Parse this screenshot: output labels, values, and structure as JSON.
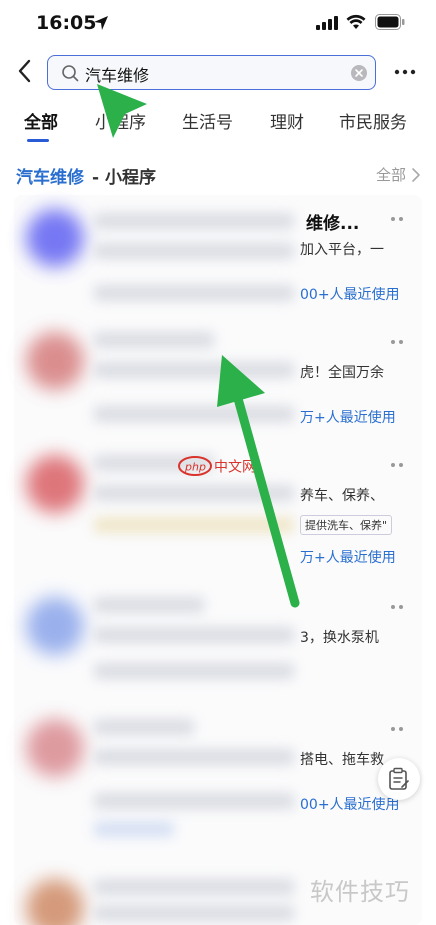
{
  "status_bar": {
    "time": "16:05"
  },
  "search": {
    "query": "汽车维修"
  },
  "tabs": [
    {
      "label": "全部",
      "active": true
    },
    {
      "label": "小程序",
      "active": false
    },
    {
      "label": "生活号",
      "active": false
    },
    {
      "label": "理财",
      "active": false
    },
    {
      "label": "市民服务",
      "active": false
    }
  ],
  "section": {
    "keyword": "汽车维修",
    "rest": " - 小程序",
    "all_label": "全部"
  },
  "results": [
    {
      "title": "维修...",
      "desc": "加入平台，一",
      "users": "00+人最近使用",
      "tag": "",
      "avatar_color": "#4a4cf0"
    },
    {
      "title": "",
      "desc": "虎！全国万余",
      "users": "万+人最近使用",
      "tag": "",
      "avatar_color": "#d06a6a"
    },
    {
      "title": "",
      "desc": "养车、保养、",
      "users": "万+人最近使用",
      "tag": "提供洗车、保养\"",
      "avatar_color": "#d44a50"
    },
    {
      "title": "",
      "desc": "3，换水泵机",
      "users": "",
      "tag": "",
      "avatar_color": "#7a98e8"
    },
    {
      "title": "",
      "desc": "搭电、拖车救",
      "users": "00+人最近使用",
      "tag": "",
      "avatar_color": "#d47a80"
    },
    {
      "title": "",
      "desc": "",
      "users": "",
      "tag": "",
      "avatar_color": "#c87a50"
    }
  ],
  "watermark": {
    "logo_text": "php中文网",
    "bottom_text": "软件技巧"
  },
  "colors": {
    "accent": "#2a6fd0",
    "arrow": "#2bb04a"
  }
}
